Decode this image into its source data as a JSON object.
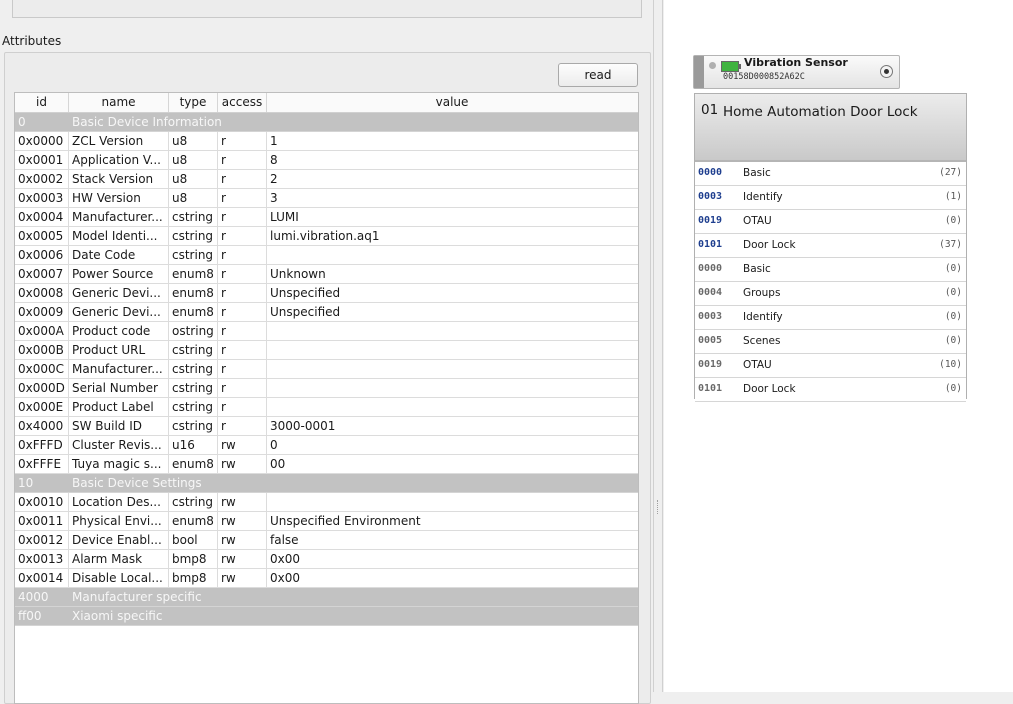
{
  "attributes_label": "Attributes",
  "read_button": "read",
  "table": {
    "headers": [
      "id",
      "name",
      "type",
      "access",
      "value"
    ],
    "rows": [
      {
        "section": true,
        "id": "0",
        "name": "Basic Device Information"
      },
      {
        "id": "0x0000",
        "name": "ZCL Version",
        "type": "u8",
        "access": "r",
        "value": "1"
      },
      {
        "id": "0x0001",
        "name": "Application V...",
        "type": "u8",
        "access": "r",
        "value": "8"
      },
      {
        "id": "0x0002",
        "name": "Stack Version",
        "type": "u8",
        "access": "r",
        "value": "2"
      },
      {
        "id": "0x0003",
        "name": "HW Version",
        "type": "u8",
        "access": "r",
        "value": "3"
      },
      {
        "id": "0x0004",
        "name": "Manufacturer...",
        "type": "cstring",
        "access": "r",
        "value": "LUMI"
      },
      {
        "id": "0x0005",
        "name": "Model Identi...",
        "type": "cstring",
        "access": "r",
        "value": "lumi.vibration.aq1"
      },
      {
        "id": "0x0006",
        "name": "Date Code",
        "type": "cstring",
        "access": "r",
        "value": ""
      },
      {
        "id": "0x0007",
        "name": "Power Source",
        "type": "enum8",
        "access": "r",
        "value": "Unknown"
      },
      {
        "id": "0x0008",
        "name": "Generic Devi...",
        "type": "enum8",
        "access": "r",
        "value": "Unspecified"
      },
      {
        "id": "0x0009",
        "name": "Generic Devi...",
        "type": "enum8",
        "access": "r",
        "value": "Unspecified"
      },
      {
        "id": "0x000A",
        "name": "Product code",
        "type": "ostring",
        "access": "r",
        "value": ""
      },
      {
        "id": "0x000B",
        "name": "Product URL",
        "type": "cstring",
        "access": "r",
        "value": ""
      },
      {
        "id": "0x000C",
        "name": "Manufacturer...",
        "type": "cstring",
        "access": "r",
        "value": ""
      },
      {
        "id": "0x000D",
        "name": "Serial Number",
        "type": "cstring",
        "access": "r",
        "value": ""
      },
      {
        "id": "0x000E",
        "name": "Product Label",
        "type": "cstring",
        "access": "r",
        "value": ""
      },
      {
        "id": "0x4000",
        "name": "SW Build ID",
        "type": "cstring",
        "access": "r",
        "value": "3000-0001"
      },
      {
        "id": "0xFFFD",
        "name": "Cluster Revis...",
        "type": "u16",
        "access": "rw",
        "value": "0"
      },
      {
        "id": "0xFFFE",
        "name": "Tuya magic s...",
        "type": "enum8",
        "access": "rw",
        "value": "00"
      },
      {
        "section": true,
        "id": "10",
        "name": "Basic Device Settings"
      },
      {
        "id": "0x0010",
        "name": "Location Des...",
        "type": "cstring",
        "access": "rw",
        "value": ""
      },
      {
        "id": "0x0011",
        "name": "Physical Envi...",
        "type": "enum8",
        "access": "rw",
        "value": "Unspecified Environment"
      },
      {
        "id": "0x0012",
        "name": "Device Enabl...",
        "type": "bool",
        "access": "rw",
        "value": "false"
      },
      {
        "id": "0x0013",
        "name": "Alarm Mask",
        "type": "bmp8",
        "access": "rw",
        "value": "0x00"
      },
      {
        "id": "0x0014",
        "name": "Disable Local...",
        "type": "bmp8",
        "access": "rw",
        "value": "0x00"
      },
      {
        "section": true,
        "id": "4000",
        "name": "Manufacturer specific"
      },
      {
        "section": true,
        "id": "ff00",
        "name": "Xiaomi specific"
      }
    ]
  },
  "node": {
    "name": "Vibration Sensor",
    "mac": "00158D000852A62C",
    "battery_color": "#3fb33f"
  },
  "endpoint": {
    "number": "01",
    "title": "Home Automation Door Lock",
    "clusters": [
      {
        "id": "0000",
        "name": "Basic",
        "count": "(27)",
        "server": true
      },
      {
        "id": "0003",
        "name": "Identify",
        "count": "(1)",
        "server": true
      },
      {
        "id": "0019",
        "name": "OTAU",
        "count": "(0)",
        "server": true
      },
      {
        "id": "0101",
        "name": "Door Lock",
        "count": "(37)",
        "server": true
      },
      {
        "id": "0000",
        "name": "Basic",
        "count": "(0)",
        "server": false
      },
      {
        "id": "0004",
        "name": "Groups",
        "count": "(0)",
        "server": false
      },
      {
        "id": "0003",
        "name": "Identify",
        "count": "(0)",
        "server": false
      },
      {
        "id": "0005",
        "name": "Scenes",
        "count": "(0)",
        "server": false
      },
      {
        "id": "0019",
        "name": "OTAU",
        "count": "(10)",
        "server": false
      },
      {
        "id": "0101",
        "name": "Door Lock",
        "count": "(0)",
        "server": false
      }
    ],
    "server_id_color": "#1f3f8f",
    "client_id_color": "#6a6a6a"
  }
}
